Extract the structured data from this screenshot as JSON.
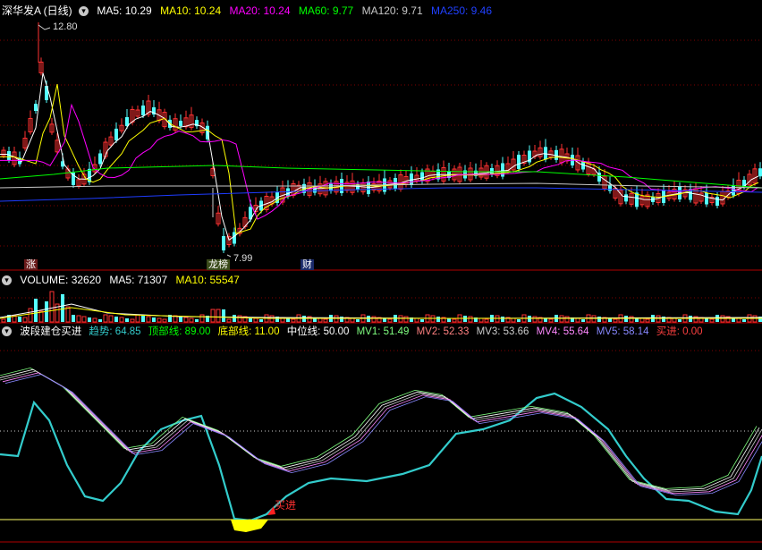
{
  "main_header": {
    "title": "深华发A (日线)",
    "ma5_label": "MA5: 10.29",
    "ma10_label": "MA10: 10.24",
    "ma20_label": "MA20: 10.24",
    "ma60_label": "MA60: 9.77",
    "ma120_label": "MA120: 9.71",
    "ma250_label": "MA250: 9.46"
  },
  "price_labels": {
    "high": "12.80",
    "low": "7.99"
  },
  "markers": {
    "zhang": "涨",
    "longhu": "龙榜",
    "cai": "财"
  },
  "volume_header": {
    "title": "VOLUME: 32620",
    "ma5_label": "MA5: 71307",
    "ma10_label": "MA10: 55547"
  },
  "indicator_header": {
    "title": "波段建仓买进",
    "trend_label": "趋势: 64.85",
    "top_label": "顶部线: 89.00",
    "bottom_label": "底部线: 11.00",
    "mid_label": "中位线: 50.00",
    "mv1_label": "MV1: 51.49",
    "mv2_label": "MV2: 52.33",
    "mv3_label": "MV3: 53.66",
    "mv4_label": "MV4: 55.64",
    "mv5_label": "MV5: 58.14",
    "buy_label": "买进: 0.00"
  },
  "buy_signal": "买进",
  "colors": {
    "ma5": "#ffffff",
    "ma10": "#ffff00",
    "ma20": "#ff00ff",
    "ma60": "#00ff00",
    "ma120": "#c8c8c8",
    "ma250": "#1e3cff",
    "up": "#ff3232",
    "down": "#54ffff",
    "trend": "#33cccc",
    "mv1": "#80ff80",
    "mv2": "#ffffff",
    "mv3": "#cccccc",
    "mv4": "#ff88ff",
    "mv5": "#8888ff",
    "grid": "#800000"
  }
}
